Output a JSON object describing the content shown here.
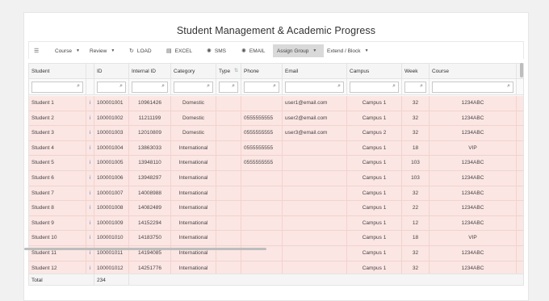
{
  "page": {
    "title": "Student Management & Academic Progress"
  },
  "toolbar": {
    "list_icon": "☰",
    "course": "Course",
    "review": "Review",
    "load": "LOAD",
    "excel": "EXCEL",
    "sms": "SMS",
    "email": "EMAIL",
    "assign_group": "Assign Group",
    "extend_block": "Extend / Block"
  },
  "columns": [
    "Student",
    "",
    "ID",
    "Internal ID",
    "Category",
    "Type",
    "Phone",
    "Email",
    "Campus",
    "Week",
    "Course"
  ],
  "rows": [
    {
      "student": "Student 1",
      "info": "i",
      "id": "100001001",
      "internal": "10961426",
      "category": "Domestic",
      "type": "",
      "phone": "",
      "email": "user1@email.com",
      "campus": "Campus 1",
      "week": "32",
      "course": "1234ABC"
    },
    {
      "student": "Student 2",
      "info": "i",
      "id": "100001002",
      "internal": "11211199",
      "category": "Domestic",
      "type": "",
      "phone": "0555555555",
      "email": "user2@email.com",
      "campus": "Campus 1",
      "week": "32",
      "course": "1234ABC"
    },
    {
      "student": "Student 3",
      "info": "i",
      "id": "100001003",
      "internal": "12010809",
      "category": "Domestic",
      "type": "",
      "phone": "0555555555",
      "email": "user3@email.com",
      "campus": "Campus 2",
      "week": "32",
      "course": "1234ABC"
    },
    {
      "student": "Student 4",
      "info": "i",
      "id": "100001004",
      "internal": "13863033",
      "category": "International",
      "type": "",
      "phone": "0555555555",
      "email": "",
      "campus": "Campus 1",
      "week": "18",
      "course": "VIP"
    },
    {
      "student": "Student 5",
      "info": "i",
      "id": "100001005",
      "internal": "13948110",
      "category": "International",
      "type": "",
      "phone": "0555555555",
      "email": "",
      "campus": "Campus 1",
      "week": "103",
      "course": "1234ABC"
    },
    {
      "student": "Student 6",
      "info": "i",
      "id": "100001006",
      "internal": "13948297",
      "category": "International",
      "type": "",
      "phone": "",
      "email": "",
      "campus": "Campus 1",
      "week": "103",
      "course": "1234ABC"
    },
    {
      "student": "Student 7",
      "info": "i",
      "id": "100001007",
      "internal": "14008988",
      "category": "International",
      "type": "",
      "phone": "",
      "email": "",
      "campus": "Campus 1",
      "week": "32",
      "course": "1234ABC"
    },
    {
      "student": "Student 8",
      "info": "i",
      "id": "100001008",
      "internal": "14082489",
      "category": "International",
      "type": "",
      "phone": "",
      "email": "",
      "campus": "Campus 1",
      "week": "22",
      "course": "1234ABC"
    },
    {
      "student": "Student 9",
      "info": "i",
      "id": "100001009",
      "internal": "14152294",
      "category": "International",
      "type": "",
      "phone": "",
      "email": "",
      "campus": "Campus 1",
      "week": "12",
      "course": "1234ABC"
    },
    {
      "student": "Student 10",
      "info": "i",
      "id": "100001010",
      "internal": "14183750",
      "category": "International",
      "type": "",
      "phone": "",
      "email": "",
      "campus": "Campus 1",
      "week": "18",
      "course": "VIP"
    },
    {
      "student": "Student 11",
      "info": "i",
      "id": "100001011",
      "internal": "14194085",
      "category": "International",
      "type": "",
      "phone": "",
      "email": "",
      "campus": "Campus 1",
      "week": "32",
      "course": "1234ABC"
    },
    {
      "student": "Student 12",
      "info": "i",
      "id": "100001012",
      "internal": "14251776",
      "category": "International",
      "type": "",
      "phone": "",
      "email": "",
      "campus": "Campus 1",
      "week": "32",
      "course": "1234ABC"
    }
  ],
  "footer": {
    "label": "Total",
    "count": "234"
  }
}
